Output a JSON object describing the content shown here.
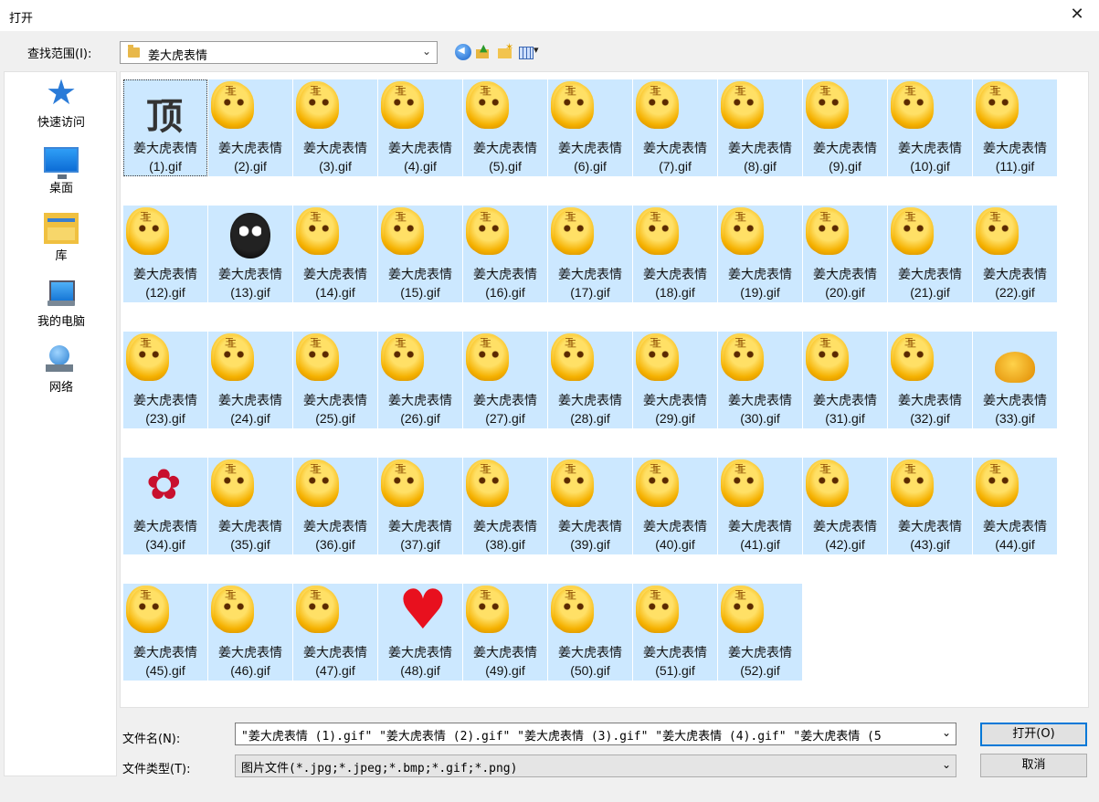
{
  "window": {
    "title": "打开",
    "close_glyph": "✕"
  },
  "lookin": {
    "label": "查找范围(I):",
    "value": "姜大虎表情",
    "dropdown_glyph": "⌄"
  },
  "toolbar": {
    "icons": [
      "back-icon",
      "up-folder-icon",
      "new-folder-icon",
      "view-menu-icon"
    ]
  },
  "places": [
    {
      "label": "快速访问",
      "icon": "star-icon"
    },
    {
      "label": "桌面",
      "icon": "desktop-icon"
    },
    {
      "label": "库",
      "icon": "library-icon"
    },
    {
      "label": "我的电脑",
      "icon": "computer-icon"
    },
    {
      "label": "网络",
      "icon": "network-icon"
    }
  ],
  "files": [
    {
      "line1": "姜大虎表情",
      "line2": "(1).gif",
      "thumb": "ding"
    },
    {
      "line1": "姜大虎表情",
      "line2": "(2).gif",
      "thumb": "tiger"
    },
    {
      "line1": "姜大虎表情",
      "line2": "(3).gif",
      "thumb": "tiger"
    },
    {
      "line1": "姜大虎表情",
      "line2": "(4).gif",
      "thumb": "tiger"
    },
    {
      "line1": "姜大虎表情",
      "line2": "(5).gif",
      "thumb": "tiger"
    },
    {
      "line1": "姜大虎表情",
      "line2": "(6).gif",
      "thumb": "tiger"
    },
    {
      "line1": "姜大虎表情",
      "line2": "(7).gif",
      "thumb": "tiger"
    },
    {
      "line1": "姜大虎表情",
      "line2": "(8).gif",
      "thumb": "tiger"
    },
    {
      "line1": "姜大虎表情",
      "line2": "(9).gif",
      "thumb": "tiger"
    },
    {
      "line1": "姜大虎表情",
      "line2": "(10).gif",
      "thumb": "tiger"
    },
    {
      "line1": "姜大虎表情",
      "line2": "(11).gif",
      "thumb": "tiger"
    },
    {
      "line1": "姜大虎表情",
      "line2": "(12).gif",
      "thumb": "tiger"
    },
    {
      "line1": "姜大虎表情",
      "line2": "(13).gif",
      "thumb": "bear"
    },
    {
      "line1": "姜大虎表情",
      "line2": "(14).gif",
      "thumb": "tiger"
    },
    {
      "line1": "姜大虎表情",
      "line2": "(15).gif",
      "thumb": "tiger"
    },
    {
      "line1": "姜大虎表情",
      "line2": "(16).gif",
      "thumb": "tiger"
    },
    {
      "line1": "姜大虎表情",
      "line2": "(17).gif",
      "thumb": "tiger"
    },
    {
      "line1": "姜大虎表情",
      "line2": "(18).gif",
      "thumb": "tiger"
    },
    {
      "line1": "姜大虎表情",
      "line2": "(19).gif",
      "thumb": "tiger"
    },
    {
      "line1": "姜大虎表情",
      "line2": "(20).gif",
      "thumb": "tiger"
    },
    {
      "line1": "姜大虎表情",
      "line2": "(21).gif",
      "thumb": "tiger"
    },
    {
      "line1": "姜大虎表情",
      "line2": "(22).gif",
      "thumb": "tiger"
    },
    {
      "line1": "姜大虎表情",
      "line2": "(23).gif",
      "thumb": "tiger"
    },
    {
      "line1": "姜大虎表情",
      "line2": "(24).gif",
      "thumb": "tiger"
    },
    {
      "line1": "姜大虎表情",
      "line2": "(25).gif",
      "thumb": "tiger"
    },
    {
      "line1": "姜大虎表情",
      "line2": "(26).gif",
      "thumb": "tiger"
    },
    {
      "line1": "姜大虎表情",
      "line2": "(27).gif",
      "thumb": "tiger"
    },
    {
      "line1": "姜大虎表情",
      "line2": "(28).gif",
      "thumb": "tiger"
    },
    {
      "line1": "姜大虎表情",
      "line2": "(29).gif",
      "thumb": "tiger"
    },
    {
      "line1": "姜大虎表情",
      "line2": "(30).gif",
      "thumb": "tiger"
    },
    {
      "line1": "姜大虎表情",
      "line2": "(31).gif",
      "thumb": "tiger"
    },
    {
      "line1": "姜大虎表情",
      "line2": "(32).gif",
      "thumb": "tiger"
    },
    {
      "line1": "姜大虎表情",
      "line2": "(33).gif",
      "thumb": "poop"
    },
    {
      "line1": "姜大虎表情",
      "line2": "(34).gif",
      "thumb": "rose"
    },
    {
      "line1": "姜大虎表情",
      "line2": "(35).gif",
      "thumb": "tiger"
    },
    {
      "line1": "姜大虎表情",
      "line2": "(36).gif",
      "thumb": "tiger"
    },
    {
      "line1": "姜大虎表情",
      "line2": "(37).gif",
      "thumb": "tiger"
    },
    {
      "line1": "姜大虎表情",
      "line2": "(38).gif",
      "thumb": "tiger"
    },
    {
      "line1": "姜大虎表情",
      "line2": "(39).gif",
      "thumb": "tiger"
    },
    {
      "line1": "姜大虎表情",
      "line2": "(40).gif",
      "thumb": "tiger"
    },
    {
      "line1": "姜大虎表情",
      "line2": "(41).gif",
      "thumb": "tiger"
    },
    {
      "line1": "姜大虎表情",
      "line2": "(42).gif",
      "thumb": "tiger"
    },
    {
      "line1": "姜大虎表情",
      "line2": "(43).gif",
      "thumb": "tiger"
    },
    {
      "line1": "姜大虎表情",
      "line2": "(44).gif",
      "thumb": "tiger"
    },
    {
      "line1": "姜大虎表情",
      "line2": "(45).gif",
      "thumb": "tiger"
    },
    {
      "line1": "姜大虎表情",
      "line2": "(46).gif",
      "thumb": "tiger"
    },
    {
      "line1": "姜大虎表情",
      "line2": "(47).gif",
      "thumb": "tiger"
    },
    {
      "line1": "姜大虎表情",
      "line2": "(48).gif",
      "thumb": "heart"
    },
    {
      "line1": "姜大虎表情",
      "line2": "(49).gif",
      "thumb": "tiger"
    },
    {
      "line1": "姜大虎表情",
      "line2": "(50).gif",
      "thumb": "tiger"
    },
    {
      "line1": "姜大虎表情",
      "line2": "(51).gif",
      "thumb": "tiger"
    },
    {
      "line1": "姜大虎表情",
      "line2": "(52).gif",
      "thumb": "tiger"
    }
  ],
  "filename": {
    "label": "文件名(N):",
    "value": "\"姜大虎表情 (1).gif\" \"姜大虎表情 (2).gif\" \"姜大虎表情 (3).gif\" \"姜大虎表情 (4).gif\" \"姜大虎表情 (5",
    "dropdown_glyph": "⌄"
  },
  "filetype": {
    "label": "文件类型(T):",
    "value": "图片文件(*.jpg;*.jpeg;*.bmp;*.gif;*.png)",
    "dropdown_glyph": "⌄"
  },
  "buttons": {
    "open": "打开(O)",
    "cancel": "取消"
  },
  "colors": {
    "selection": "#cce8ff",
    "accent": "#0078d7"
  }
}
